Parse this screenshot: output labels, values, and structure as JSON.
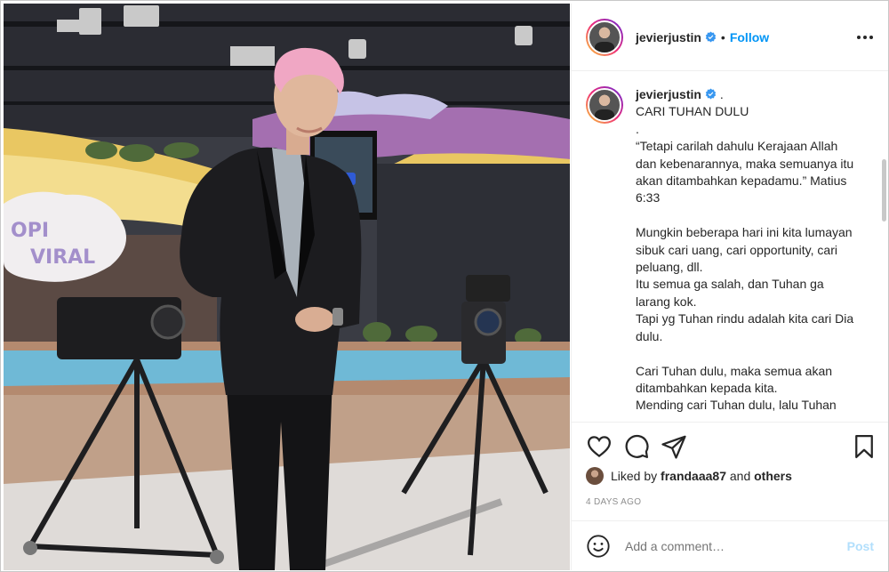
{
  "post": {
    "username": "jevierjustin",
    "follow_label": "Follow",
    "dot": "•",
    "caption_dot": ".",
    "caption_lines": [
      "CARI TUHAN DULU",
      ".",
      "“Tetapi carilah dahulu Kerajaan Allah dan kebenarannya, maka semuanya itu akan ditambahkan kepadamu.” Matius 6:33",
      "",
      "Mungkin beberapa hari ini kita lumayan sibuk cari uang, cari opportunity, cari peluang, dll.",
      "Itu semua ga salah, dan Tuhan ga larang kok.",
      "Tapi yg Tuhan rindu adalah kita cari Dia dulu.",
      "",
      "Cari Tuhan dulu, maka semua akan ditambahkan kepada kita.",
      "Mending cari Tuhan dulu, lalu Tuhan"
    ],
    "liked_prefix": "Liked by",
    "liked_user": "frandaaa87",
    "liked_and": "and",
    "liked_others": "others",
    "age": "4 DAYS AGO",
    "comment_placeholder": "Add a comment…",
    "post_label": "Post",
    "photo_sign_text": "OPI VIRAL"
  },
  "colors": {
    "link_blue": "#0095f6",
    "post_disabled": "#b2dffc",
    "muted": "#8e8e8e",
    "verified": "#3897f0"
  },
  "icons": [
    "more-icon",
    "verified-badge-icon",
    "heart-icon",
    "comment-icon",
    "share-icon",
    "bookmark-icon",
    "smile-icon"
  ]
}
